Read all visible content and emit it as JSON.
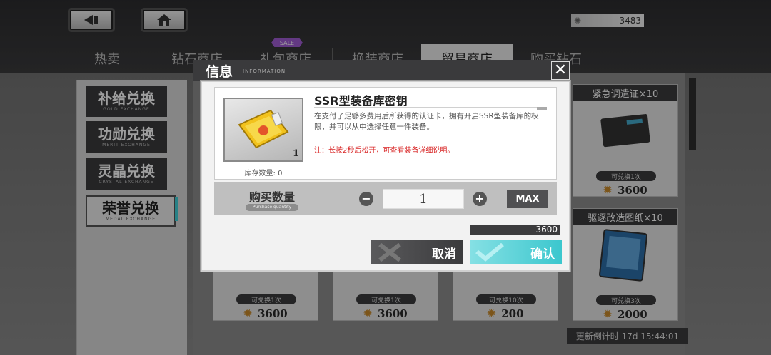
{
  "top": {
    "currency_value": "3483",
    "currency_icon": "medal-icon"
  },
  "tabs": [
    {
      "label": "热卖"
    },
    {
      "label": "钻石商店"
    },
    {
      "label": "礼包商店",
      "badge": "SALE"
    },
    {
      "label": "换装商店"
    },
    {
      "label": "贸易商店",
      "active": true
    },
    {
      "label": "购买钻石"
    }
  ],
  "sidebar": [
    {
      "label": "补给兑换",
      "sub": "GOLD EXCHANGE"
    },
    {
      "label": "功勋兑换",
      "sub": "MERIT EXCHANGE"
    },
    {
      "label": "灵晶兑换",
      "sub": "CRYSTAL EXCHANGE"
    },
    {
      "label": "荣誉兑换",
      "sub": "MEDAL EXCHANGE",
      "active": true
    }
  ],
  "cards": [
    {
      "title": "紧急调遣证×10",
      "stock": "可兑换1次",
      "price": "3600"
    },
    {
      "title": "驱逐改造图纸×10",
      "stock": "可兑换3次",
      "price": "2000"
    },
    {
      "stock": "可兑换1次",
      "price": "3600"
    },
    {
      "stock": "可兑换1次",
      "price": "3600"
    },
    {
      "stock": "可兑换10次",
      "price": "200"
    }
  ],
  "refresh_text": "更新倒计时 17d 15:44:01",
  "dialog": {
    "title": "信息",
    "subtitle": "INFORMATION",
    "item_name": "SSR型装备库密钥",
    "item_count": "1",
    "stock_label": "库存数量: 0",
    "description": "在支付了足够多费用后所获得的认证卡，拥有开启SSR型装备库的权限，并可以从中选择任意一件装备。",
    "note": "注：长按2秒后松开，可查看装备详细说明。",
    "qty_label": "购买数量",
    "qty_sub": "Purchase quantity",
    "qty_value": "1",
    "minus": "−",
    "plus": "+",
    "max_label": "MAX",
    "total": "3600",
    "cancel_label": "取消",
    "confirm_label": "确认",
    "close_symbol": "✕"
  }
}
